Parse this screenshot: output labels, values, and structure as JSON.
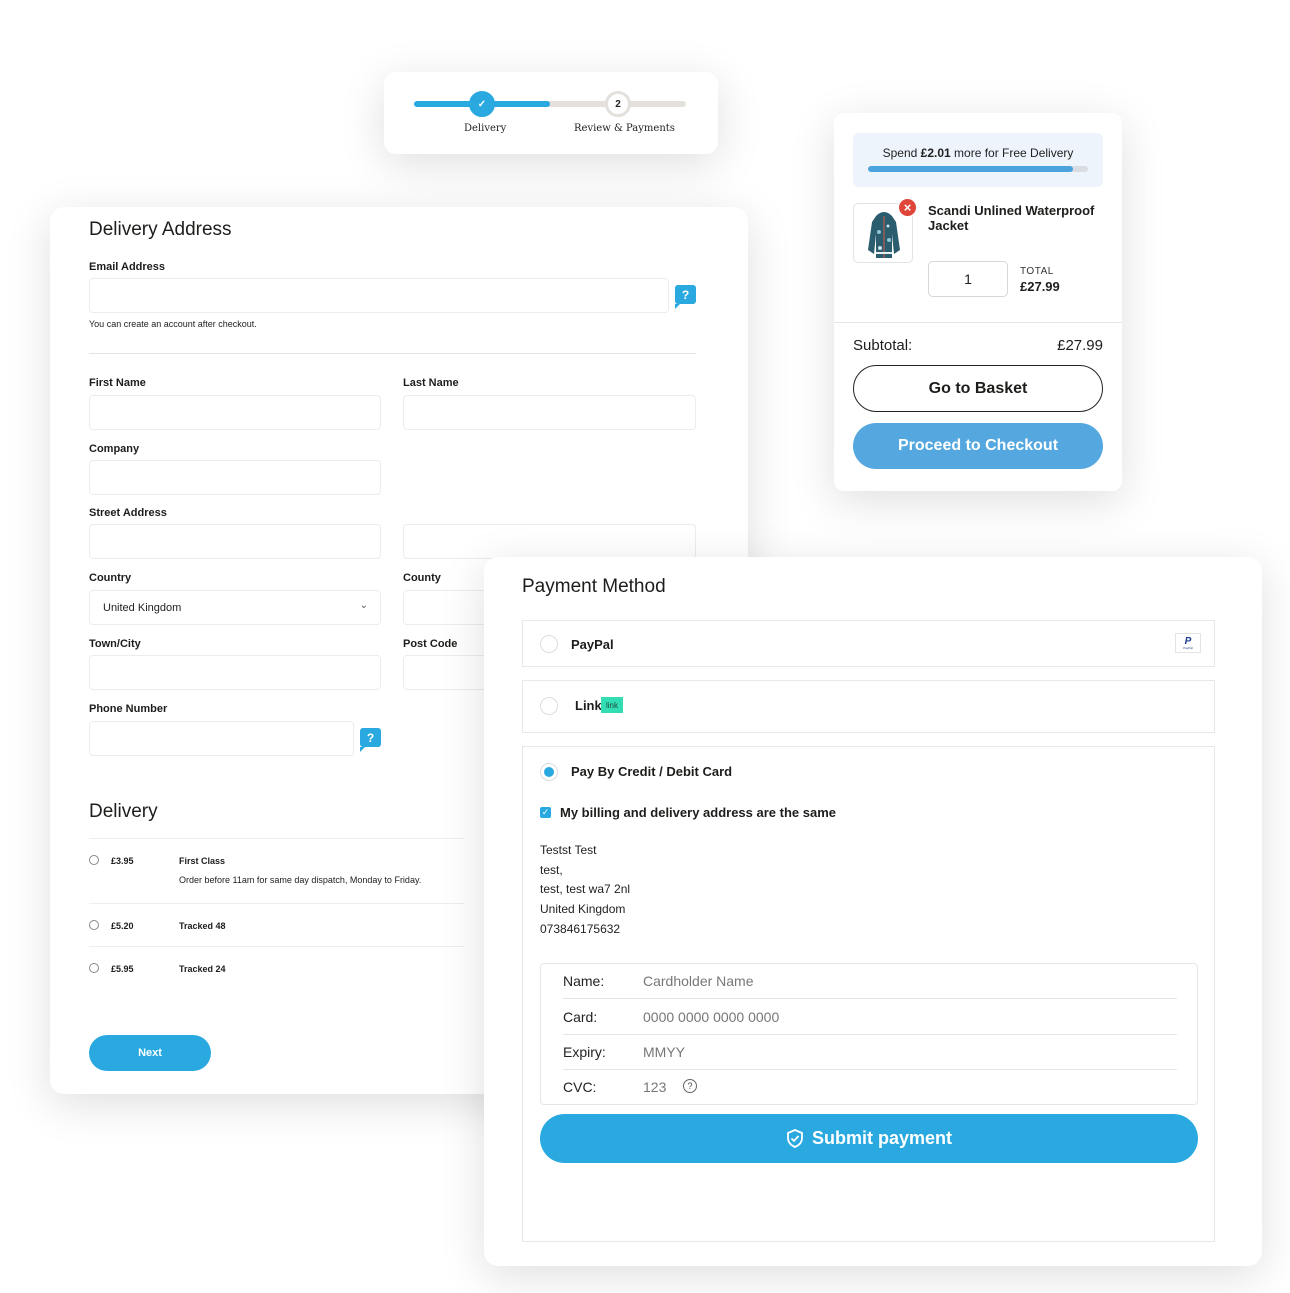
{
  "stepper": {
    "steps": [
      {
        "label": "Delivery",
        "state": "complete",
        "marker": "✓"
      },
      {
        "label": "Review & Payments",
        "state": "current",
        "marker": "2"
      }
    ],
    "progress_fraction": 0.5
  },
  "minicart": {
    "free_delivery": {
      "prefix": "Spend ",
      "amount": "£2.01",
      "suffix": " more for Free Delivery",
      "progress_percent": 93
    },
    "item": {
      "name": "Scandi Unlined Waterproof Jacket",
      "quantity": "1",
      "total_label": "TOTAL",
      "total_value": "£27.99",
      "remove_icon": "close-icon"
    },
    "subtotal_label": "Subtotal:",
    "subtotal_value": "£27.99",
    "go_to_basket": "Go to Basket",
    "proceed_to_checkout": "Proceed to Checkout"
  },
  "delivery_address": {
    "title": "Delivery Address",
    "email": {
      "label": "Email Address",
      "value": "",
      "hint": "You can create an account after checkout.",
      "help": "?"
    },
    "first_name": {
      "label": "First Name",
      "value": ""
    },
    "last_name": {
      "label": "Last Name",
      "value": ""
    },
    "company": {
      "label": "Company",
      "value": ""
    },
    "street": {
      "label": "Street Address",
      "value": ""
    },
    "country": {
      "label": "Country",
      "value": "United Kingdom"
    },
    "county": {
      "label": "County",
      "value": ""
    },
    "town": {
      "label": "Town/City",
      "value": ""
    },
    "postcode": {
      "label": "Post Code",
      "value": ""
    },
    "phone": {
      "label": "Phone Number",
      "value": "",
      "help": "?"
    }
  },
  "delivery": {
    "title": "Delivery",
    "options": [
      {
        "price": "£3.95",
        "name": "First Class",
        "description": "Order before 11am for same day dispatch, Monday to Friday.",
        "selected": false
      },
      {
        "price": "£5.20",
        "name": "Tracked 48",
        "description": "",
        "selected": false
      },
      {
        "price": "£5.95",
        "name": "Tracked 24",
        "description": "",
        "selected": false
      }
    ],
    "next_label": "Next"
  },
  "payment": {
    "title": "Payment Method",
    "methods": [
      {
        "label": "PayPal",
        "selected": false,
        "logo": "PayPal"
      },
      {
        "label": "Link",
        "selected": false,
        "badge": "link"
      },
      {
        "label": "Pay By Credit / Debit Card",
        "selected": true
      }
    ],
    "same_address_label": "My billing and delivery address are the same",
    "same_address_checked": true,
    "address_lines": [
      "Testst Test",
      "test,",
      "test, test wa7 2nl",
      "United Kingdom",
      "073846175632"
    ],
    "card_form": {
      "name": {
        "label": "Name:",
        "placeholder": "Cardholder Name"
      },
      "card": {
        "label": "Card:",
        "placeholder": "0000 0000 0000 0000"
      },
      "expiry": {
        "label": "Expiry:",
        "placeholder": "MMYY"
      },
      "cvc": {
        "label": "CVC:",
        "placeholder": "123",
        "help": "?"
      }
    },
    "submit_label": "Submit payment"
  },
  "colors": {
    "accent": "#29a9e0",
    "checkout_button": "#55a8df",
    "remove": "#e0453a",
    "link_badge": "#33ddb3"
  }
}
